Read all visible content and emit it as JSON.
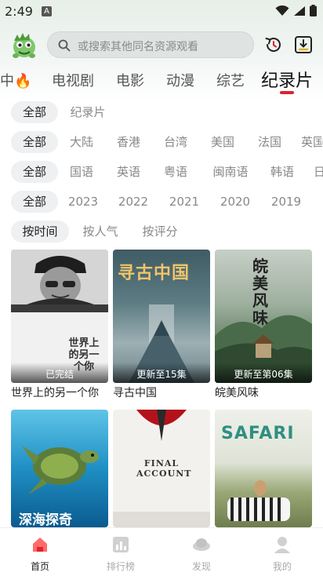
{
  "status": {
    "time": "2:49",
    "notif_glyph": "A"
  },
  "search": {
    "placeholder": "或搜索其他同名资源观看"
  },
  "categories": [
    {
      "label": "中🔥"
    },
    {
      "label": "电视剧"
    },
    {
      "label": "电影"
    },
    {
      "label": "动漫"
    },
    {
      "label": "综艺"
    },
    {
      "label": "纪录片",
      "active": true
    }
  ],
  "filters": {
    "type": [
      "全部",
      "纪录片"
    ],
    "region": [
      "全部",
      "大陆",
      "香港",
      "台湾",
      "美国",
      "法国",
      "英国"
    ],
    "language": [
      "全部",
      "国语",
      "英语",
      "粤语",
      "闽南语",
      "韩语",
      "日"
    ],
    "year": [
      "全部",
      "2023",
      "2022",
      "2021",
      "2020",
      "2019"
    ],
    "sort": [
      "按时间",
      "按人气",
      "按评分"
    ]
  },
  "cards": [
    {
      "title": "世界上的另一个你",
      "badge": "已完结",
      "poster_text": "世界上的另一个你"
    },
    {
      "title": "寻古中国",
      "badge": "更新至15集",
      "poster_text": "寻古中国"
    },
    {
      "title": "皖美风味",
      "badge": "更新至第06集",
      "poster_text": "皖美风味"
    },
    {
      "title": "",
      "badge": "",
      "poster_text": "深海探奇"
    },
    {
      "title": "",
      "badge": "",
      "poster_text": "FINAL ACCOUNT"
    },
    {
      "title": "",
      "badge": "",
      "poster_text": "SAFARI"
    }
  ],
  "nav": [
    {
      "label": "首页",
      "icon": "home-icon",
      "active": true
    },
    {
      "label": "排行榜",
      "icon": "ranking-icon"
    },
    {
      "label": "发现",
      "icon": "discover-icon"
    },
    {
      "label": "我的",
      "icon": "profile-icon"
    }
  ],
  "colors": {
    "accent": "#e0242c",
    "selected_chip_bg": "#eef0f2"
  }
}
